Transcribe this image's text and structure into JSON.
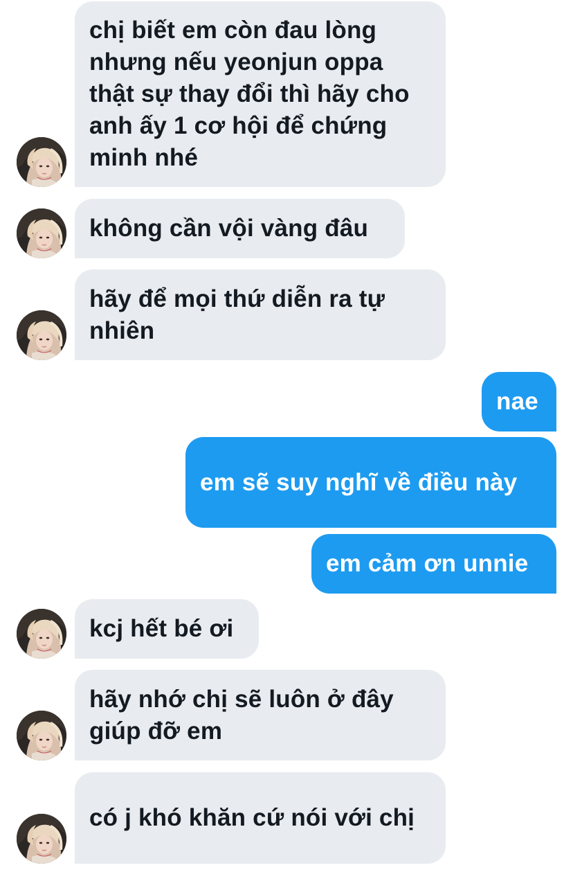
{
  "conversation": {
    "messages": [
      {
        "id": "m1",
        "direction": "incoming",
        "text": "chị biết em còn đau lòng nhưng nếu yeonjun oppa thật sự thay đổi thì hãy cho anh ấy 1 cơ hội để chứng minh nhé"
      },
      {
        "id": "m2",
        "direction": "incoming",
        "text": "không cần vội vàng đâu"
      },
      {
        "id": "m3",
        "direction": "incoming",
        "text": "hãy để mọi thứ diễn ra tự nhiên"
      },
      {
        "id": "m4",
        "direction": "outgoing",
        "text": "nae"
      },
      {
        "id": "m5",
        "direction": "outgoing",
        "text": "em sẽ suy nghĩ về điều này"
      },
      {
        "id": "m6",
        "direction": "outgoing",
        "text": "em cảm ơn unnie"
      },
      {
        "id": "m7",
        "direction": "incoming",
        "text": "kcj hết bé ơi"
      },
      {
        "id": "m8",
        "direction": "incoming",
        "text": "hãy nhớ chị sẽ luôn ở đây giúp đỡ em"
      },
      {
        "id": "m9",
        "direction": "incoming",
        "text": "có j khó khăn cứ nói với chị"
      }
    ]
  },
  "colors": {
    "incoming_bubble": "#e8ecf0",
    "incoming_text": "#141a21",
    "outgoing_bubble": "#1d9bf0",
    "outgoing_text": "#ffffff",
    "background": "#ffffff"
  },
  "icons": {
    "avatar": "contact-avatar-photo"
  }
}
